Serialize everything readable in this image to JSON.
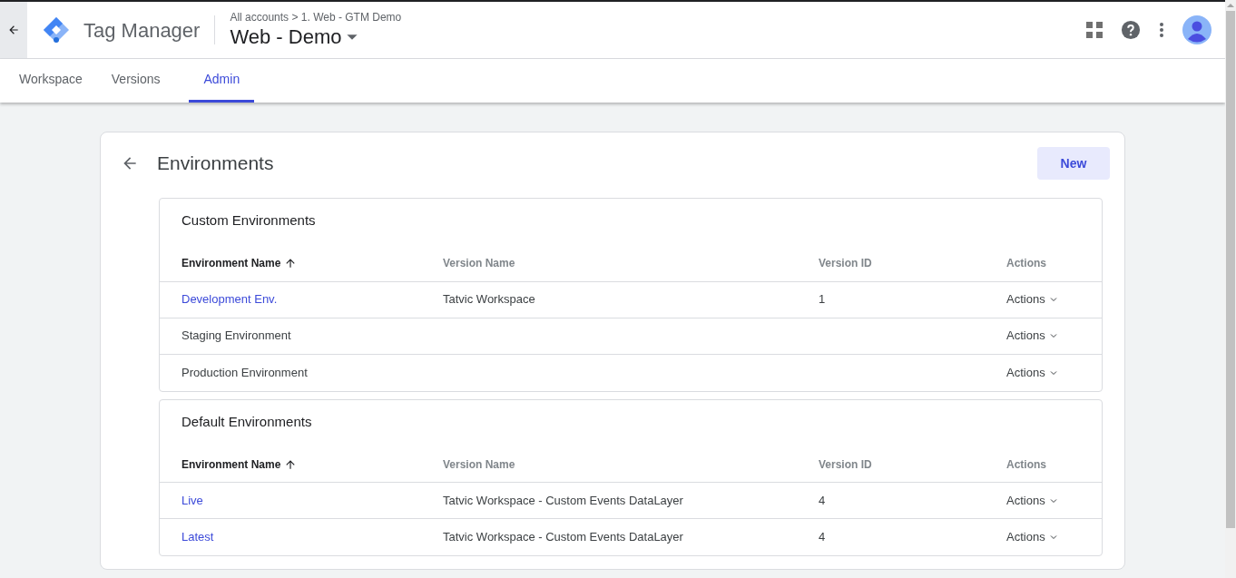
{
  "header": {
    "app_title": "Tag Manager",
    "breadcrumb": "All accounts > 1. Web - GTM Demo",
    "container": "Web - Demo"
  },
  "tabs": [
    {
      "label": "Workspace",
      "selected": false
    },
    {
      "label": "Versions",
      "selected": false
    },
    {
      "label": "Admin",
      "selected": true
    }
  ],
  "page": {
    "title": "Environments",
    "new_button": "New"
  },
  "sections": [
    {
      "title": "Custom Environments",
      "columns": [
        "Environment Name",
        "Version Name",
        "Version ID",
        "Actions"
      ],
      "rows": [
        {
          "name": "Development Env.",
          "linked": true,
          "version_name": "Tatvic Workspace",
          "version_id": "1",
          "actions": "Actions"
        },
        {
          "name": "Staging Environment",
          "linked": false,
          "version_name": "",
          "version_id": "",
          "actions": "Actions"
        },
        {
          "name": "Production Environment",
          "linked": false,
          "version_name": "",
          "version_id": "",
          "actions": "Actions"
        }
      ]
    },
    {
      "title": "Default Environments",
      "columns": [
        "Environment Name",
        "Version Name",
        "Version ID",
        "Actions"
      ],
      "rows": [
        {
          "name": "Live",
          "linked": true,
          "version_name": "Tatvic Workspace - Custom Events DataLayer",
          "version_id": "4",
          "actions": "Actions"
        },
        {
          "name": "Latest",
          "linked": true,
          "version_name": "Tatvic Workspace - Custom Events DataLayer",
          "version_id": "4",
          "actions": "Actions"
        }
      ]
    }
  ]
}
